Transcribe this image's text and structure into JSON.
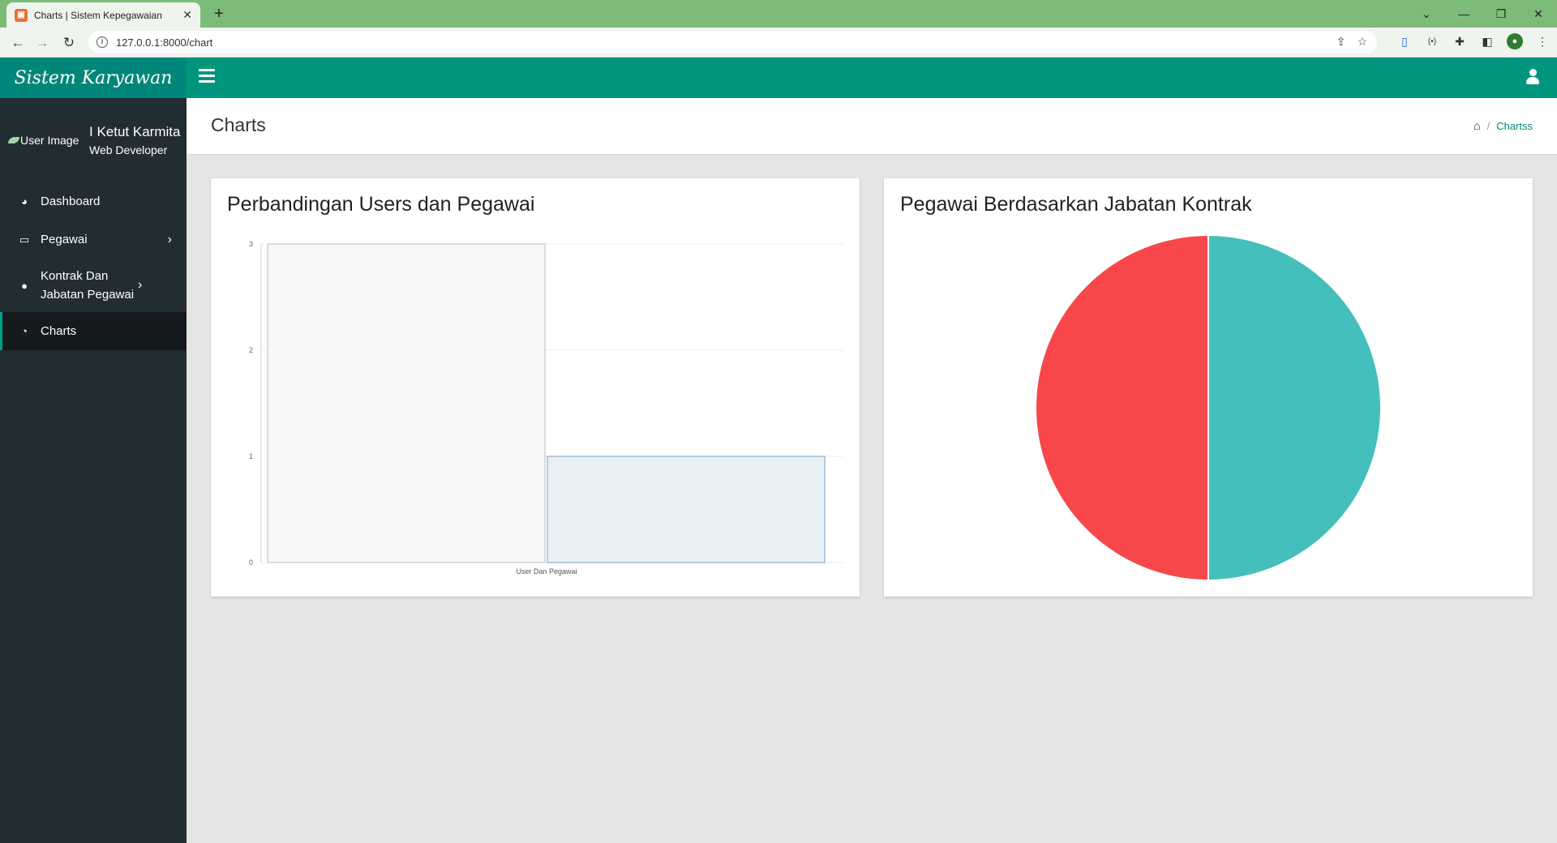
{
  "browser": {
    "tab_title": "Charts | Sistem Kepegawaian",
    "url": "127.0.0.1:8000/chart",
    "new_tab_icon": "plus-icon"
  },
  "app": {
    "brand": "Sistem Karyawan",
    "user_image_alt": "User Image",
    "user_name": "I Ketut Karmita",
    "user_role": "Web Developer",
    "menu": [
      {
        "label": "Dashboard",
        "icon": "dashboard-icon",
        "has_children": false
      },
      {
        "label": "Pegawai",
        "icon": "laptop-icon",
        "has_children": true
      },
      {
        "label": "Kontrak Dan Jabatan Pegawai",
        "icon": "user-icon",
        "has_children": true
      },
      {
        "label": "Charts",
        "icon": "pie-chart-icon",
        "has_children": false,
        "active": true
      }
    ],
    "colors": {
      "brand": "#00877a",
      "topbar": "#00967d",
      "sidebar": "#222d32",
      "pie_red": "#f7474b",
      "pie_teal": "#45bfbb"
    }
  },
  "header": {
    "page_title": "Charts",
    "breadcrumb": "Chartss"
  },
  "cards": [
    {
      "title": "Perbandingan Users dan Pegawai"
    },
    {
      "title": "Pegawai Berdasarkan Jabatan Kontrak"
    }
  ],
  "chart_data": [
    {
      "type": "bar",
      "title": "Perbandingan Users dan Pegawai",
      "categories": [
        "User Dan Pegawai"
      ],
      "series": [
        {
          "values": [
            3
          ],
          "color": "#f7f7f7",
          "border": "#d0d0d0"
        },
        {
          "values": [
            1
          ],
          "color": "#e9f0f3",
          "border": "#9dbcd4"
        }
      ],
      "ylim": [
        0,
        3
      ],
      "yticks": [
        "0",
        "1",
        "2",
        "3"
      ],
      "grid": true
    },
    {
      "type": "pie",
      "title": "Pegawai Berdasarkan Jabatan Kontrak",
      "values": [
        1,
        1
      ],
      "colors": [
        "#45bfbb",
        "#f7474b"
      ]
    }
  ]
}
